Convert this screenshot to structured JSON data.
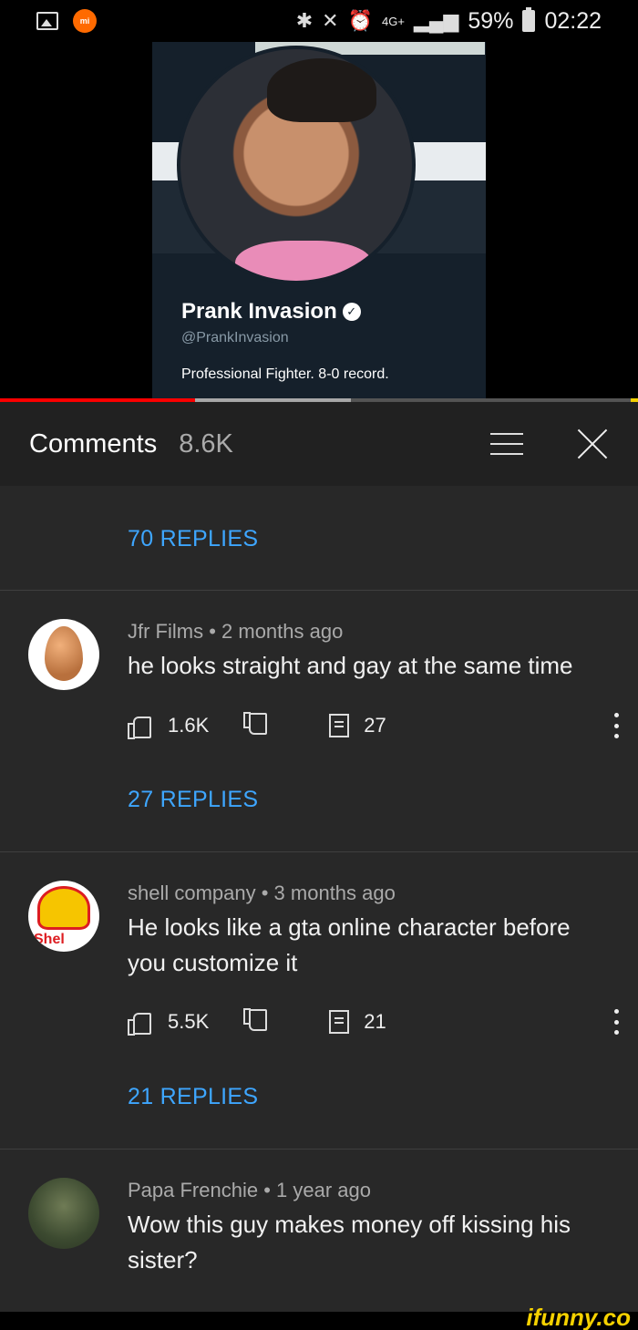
{
  "status_bar": {
    "icons": [
      "gallery-icon",
      "mi-icon",
      "bluetooth-icon",
      "mute-icon",
      "alarm-icon"
    ],
    "network": "4G+",
    "battery_percent": "59%",
    "time": "02:22"
  },
  "video": {
    "profile_name": "Prank Invasion",
    "profile_handle": "@PrankInvasion",
    "profile_bio": "Professional Fighter. 8-0 record.",
    "progress_fraction": 0.305,
    "buffer_fraction": 0.55
  },
  "comments_header": {
    "title": "Comments",
    "count": "8.6K"
  },
  "comments": {
    "replies_top": "70 REPLIES",
    "items": [
      {
        "author_meta": "Jfr Films • 2 months ago",
        "text": "he looks straight and gay at the same time",
        "likes": "1.6K",
        "reply_count": "27",
        "replies_label": "27 REPLIES",
        "avatar": "egg-avatar"
      },
      {
        "author_meta": "shell company • 3 months ago",
        "text": "He looks like a gta online character before you customize it",
        "likes": "5.5K",
        "reply_count": "21",
        "replies_label": "21 REPLIES",
        "avatar": "shell-avatar"
      },
      {
        "author_meta": "Papa Frenchie • 1 year ago",
        "text": "Wow this guy makes money off kissing his sister?",
        "avatar": "soldier-avatar"
      }
    ]
  },
  "watermark": "ifunny.co",
  "colors": {
    "accent_link": "#3ea6ff",
    "progress": "#ff0000",
    "panel_bg": "#282828",
    "header_bg": "#212121"
  }
}
